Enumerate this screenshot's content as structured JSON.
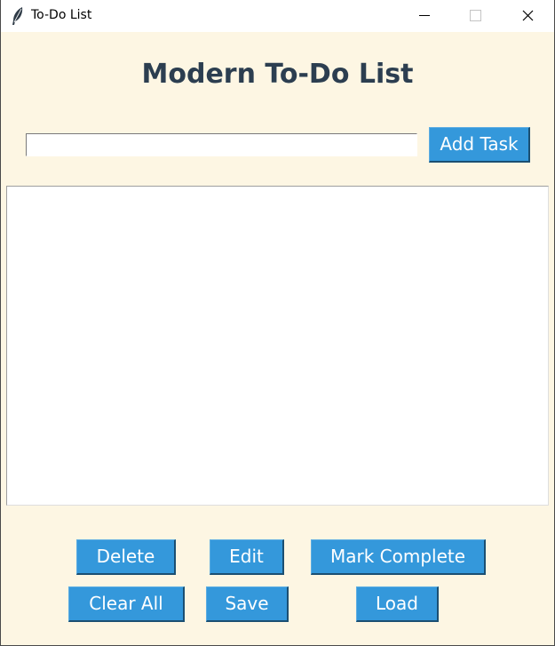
{
  "window": {
    "title": "To-Do List",
    "icon": "feather-icon",
    "controls": [
      "minimize-icon",
      "maximize-icon",
      "close-icon"
    ]
  },
  "header": {
    "title": "Modern To-Do List"
  },
  "input": {
    "value": "",
    "placeholder": ""
  },
  "buttons": {
    "add": "Add Task",
    "delete": "Delete",
    "edit": "Edit",
    "mark_complete": "Mark Complete",
    "clear_all": "Clear All",
    "save": "Save",
    "load": "Load"
  },
  "tasks": [],
  "colors": {
    "background": "#fdf6e3",
    "title": "#2c3e50",
    "button": "#3498db",
    "button_text": "#ffffff"
  }
}
